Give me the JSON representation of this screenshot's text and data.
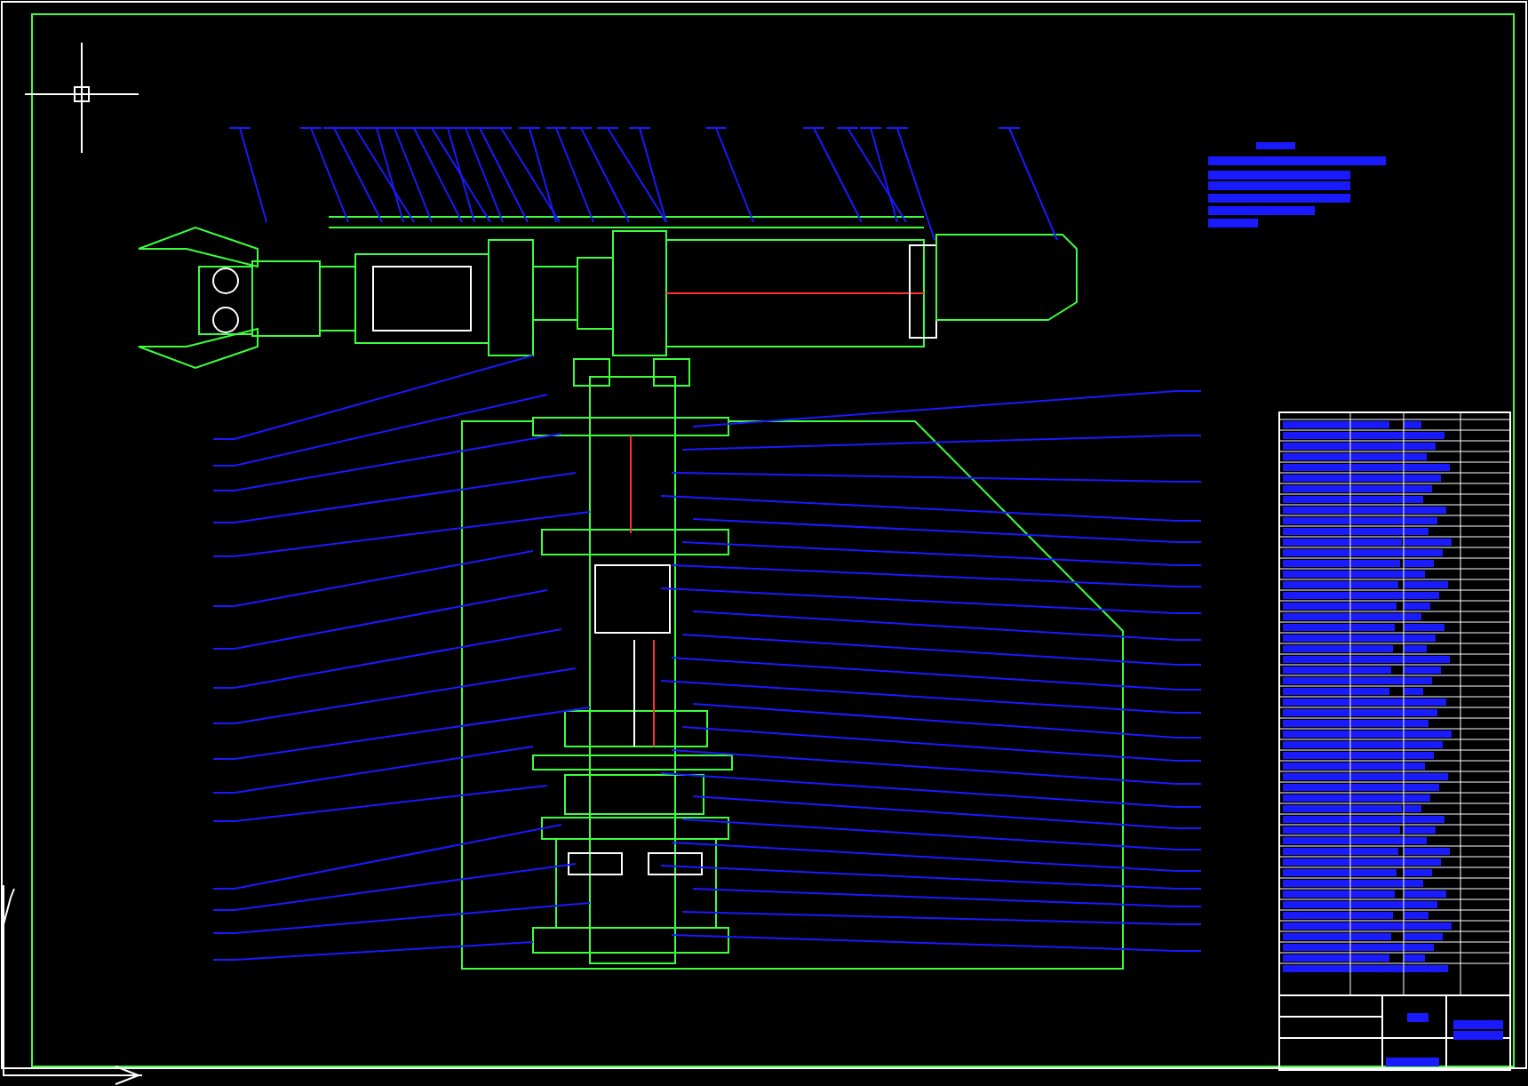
{
  "sheet": {
    "kind": "cad-drawing"
  }
}
